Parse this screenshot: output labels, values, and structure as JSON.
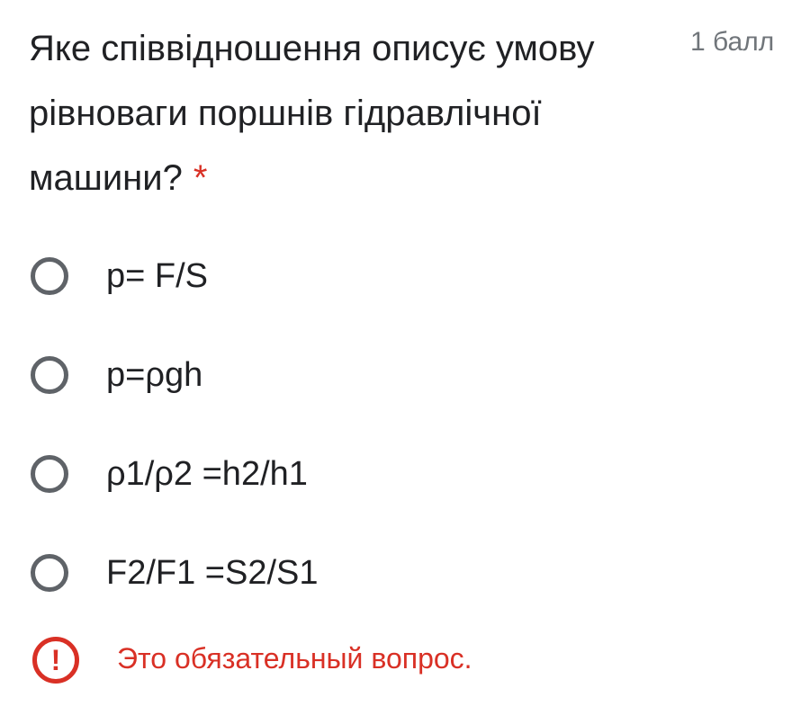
{
  "question": {
    "title": "Яке співвідношення описує умову рівноваги поршнів гідравлічної машини?",
    "required_marker": "*",
    "points": "1 балл"
  },
  "options": [
    {
      "label": "p= F/S",
      "selected": false
    },
    {
      "label": "p=ρgh",
      "selected": false
    },
    {
      "label": "ρ1/ρ2 =h2/h1",
      "selected": false
    },
    {
      "label": "F2/F1 =S2/S1",
      "selected": false
    }
  ],
  "error": {
    "icon": "exclamation-circle-icon",
    "message": "Это обязательный вопрос."
  },
  "colors": {
    "error": "#d93025",
    "radio_border": "#5f6368",
    "text": "#202124",
    "muted": "#70757a"
  }
}
